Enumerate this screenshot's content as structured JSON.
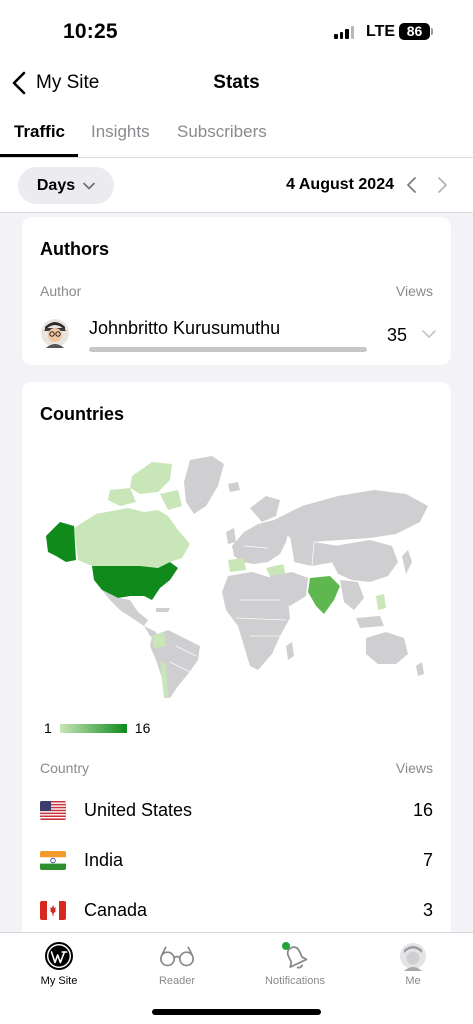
{
  "status_bar": {
    "time": "10:25",
    "network": "LTE",
    "battery": "86"
  },
  "nav": {
    "back_label": "My Site",
    "title": "Stats"
  },
  "tabs": [
    {
      "label": "Traffic",
      "active": true
    },
    {
      "label": "Insights",
      "active": false
    },
    {
      "label": "Subscribers",
      "active": false
    }
  ],
  "period": {
    "unit": "Days",
    "date": "4 August 2024"
  },
  "authors": {
    "title": "Authors",
    "column_author": "Author",
    "column_views": "Views",
    "items": [
      {
        "name": "Johnbritto Kurusumuthu",
        "views": "35"
      }
    ]
  },
  "countries": {
    "title": "Countries",
    "legend_min": "1",
    "legend_max": "16",
    "column_country": "Country",
    "column_views": "Views",
    "items": [
      {
        "name": "United States",
        "views": "16",
        "flag": "us-flag-icon"
      },
      {
        "name": "India",
        "views": "7",
        "flag": "india-flag-icon"
      },
      {
        "name": "Canada",
        "views": "3",
        "flag": "canada-flag-icon"
      }
    ]
  },
  "tab_bar": [
    {
      "label": "My Site",
      "icon": "wordpress-icon",
      "active": true
    },
    {
      "label": "Reader",
      "icon": "glasses-icon",
      "active": false
    },
    {
      "label": "Notifications",
      "icon": "bell-icon",
      "active": false
    },
    {
      "label": "Me",
      "icon": "avatar-icon",
      "active": false
    }
  ],
  "colors": {
    "map_max": "#0f8a1b",
    "map_low": "#c8e6b8",
    "map_none": "#cfcfd1",
    "notification_dot": "#1fa636"
  }
}
